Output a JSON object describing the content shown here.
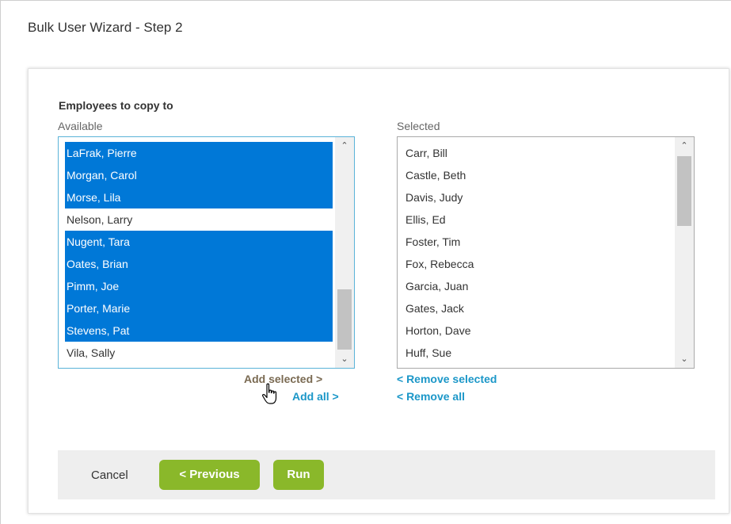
{
  "page_title": "Bulk User Wizard - Step 2",
  "section_heading": "Employees to copy to",
  "available": {
    "label": "Available",
    "items": [
      {
        "name": "LaFrak, Pierre",
        "selected": true
      },
      {
        "name": "Morgan, Carol",
        "selected": true
      },
      {
        "name": "Morse, Lila",
        "selected": true
      },
      {
        "name": "Nelson, Larry",
        "selected": false
      },
      {
        "name": "Nugent, Tara",
        "selected": true
      },
      {
        "name": "Oates, Brian",
        "selected": true
      },
      {
        "name": "Pimm, Joe",
        "selected": true
      },
      {
        "name": "Porter, Marie",
        "selected": true
      },
      {
        "name": "Stevens, Pat",
        "selected": true
      },
      {
        "name": "Vila, Sally",
        "selected": false
      }
    ]
  },
  "selected": {
    "label": "Selected",
    "items": [
      "Carr, Bill",
      "Castle, Beth",
      "Davis, Judy",
      "Ellis, Ed",
      "Foster, Tim",
      "Fox, Rebecca",
      "Garcia, Juan",
      "Gates, Jack",
      "Horton, Dave",
      "Huff, Sue"
    ]
  },
  "actions": {
    "add_selected": "Add selected >",
    "add_all": "Add all >",
    "remove_selected": "< Remove selected",
    "remove_all": "< Remove all"
  },
  "footer": {
    "cancel": "Cancel",
    "previous": "< Previous",
    "run": "Run"
  },
  "colors": {
    "selection": "#0078d7",
    "button": "#8ab82a",
    "link": "#1b97c8",
    "link_hover": "#7a6a52"
  },
  "icons": {
    "scroll_up": "chevron-up-icon",
    "scroll_down": "chevron-down-icon",
    "cursor": "hand-pointer-icon"
  }
}
